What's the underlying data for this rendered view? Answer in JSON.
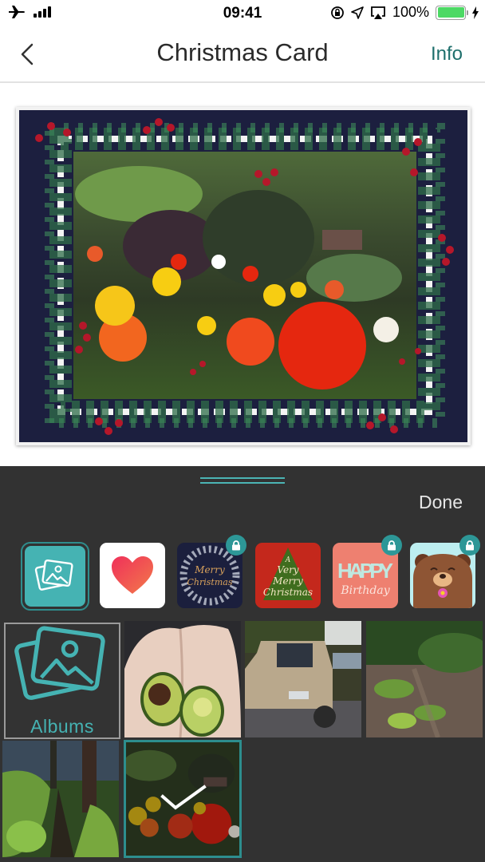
{
  "status_bar": {
    "time": "09:41",
    "battery_percent": "100%",
    "battery_level": 1.0,
    "icons": [
      "airplane-icon",
      "signal-icon",
      "orientation-lock-icon",
      "location-icon",
      "airplay-icon",
      "battery-icon",
      "charging-icon"
    ]
  },
  "nav": {
    "back_icon": "chevron-left-icon",
    "title": "Christmas Card",
    "info_label": "Info"
  },
  "card_preview": {
    "description": "Photo of red, yellow and orange poppies in a garden framed by a watercolor green leaf wreath with red berries on navy background"
  },
  "panel": {
    "done_label": "Done",
    "templates": [
      {
        "name": "photos",
        "icon": "photos-icon",
        "selected": true,
        "locked": false
      },
      {
        "name": "heart",
        "text": "",
        "locked": false
      },
      {
        "name": "merry-christmas-wreath",
        "text": "Merry Christmas",
        "locked": true
      },
      {
        "name": "very-merry-christmas-tree",
        "text": "A Very Merry Christmas",
        "locked": false
      },
      {
        "name": "happy-birthday",
        "text": "HAPPY Birthday",
        "locked": true
      },
      {
        "name": "bear",
        "text": "",
        "locked": true
      }
    ],
    "albums_label": "Albums",
    "photos": [
      {
        "name": "avocado",
        "selected": false
      },
      {
        "name": "truck",
        "selected": false
      },
      {
        "name": "garden-path",
        "selected": false
      },
      {
        "name": "forest-trail",
        "selected": false
      },
      {
        "name": "poppies",
        "selected": true
      }
    ]
  },
  "colors": {
    "accent": "#45b3b3",
    "accent_dark": "#2d8e8e",
    "info_text": "#1e6f6c",
    "panel_bg": "#323232",
    "card_bg": "#1c1f3f"
  }
}
